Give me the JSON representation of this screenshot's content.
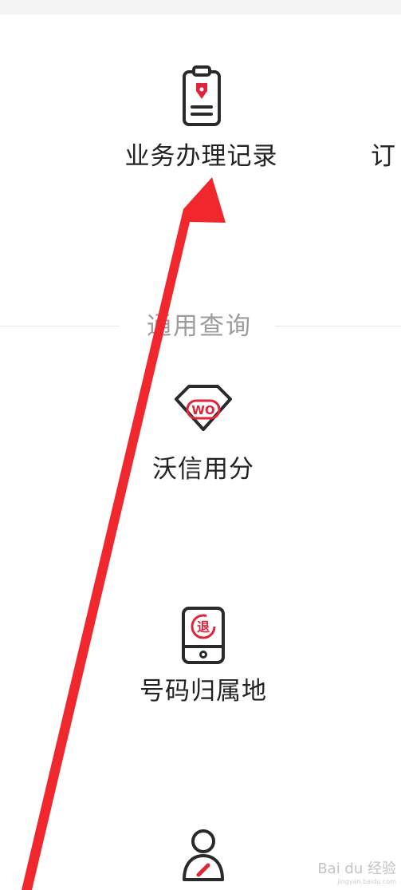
{
  "items": {
    "record": {
      "label": "业务办理记录",
      "icon": "clipboard-pen-icon"
    },
    "order": {
      "label": "订"
    },
    "credit": {
      "label": "沃信用分",
      "icon": "wo-badge-icon",
      "badge": "WO"
    },
    "phone": {
      "label": "号码归属地",
      "icon": "phone-return-icon",
      "badge": "退"
    },
    "user": {
      "icon": "user-edit-icon"
    }
  },
  "section": {
    "title": "通用查询"
  },
  "watermark": {
    "text": "Bai du 经验",
    "sub": "jingyan.baidu.com"
  },
  "colors": {
    "accent": "#e0243a",
    "arrow": "#f0282e",
    "text": "#232323",
    "muted": "#9c9c9c"
  }
}
